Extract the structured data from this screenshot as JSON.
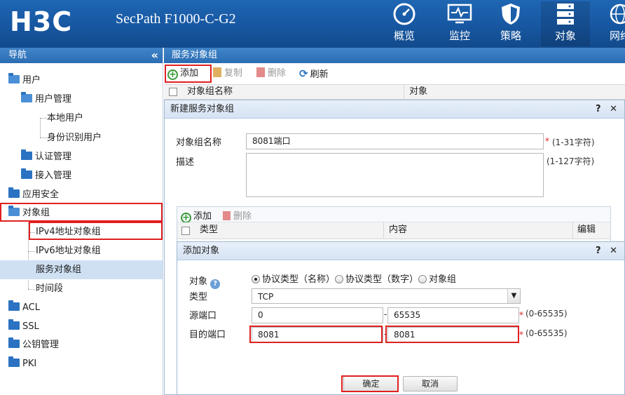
{
  "header": {
    "logo": "H3C",
    "product": "SecPath F1000-C-G2",
    "nav": [
      {
        "label": "概览",
        "icon": "gauge-icon"
      },
      {
        "label": "监控",
        "icon": "monitor-icon"
      },
      {
        "label": "策略",
        "icon": "shield-icon"
      },
      {
        "label": "对象",
        "icon": "server-stack-icon"
      },
      {
        "label": "网络",
        "icon": "globe-icon"
      }
    ],
    "active_nav": "对象"
  },
  "sidebar": {
    "title": "导航",
    "collapse": "«",
    "items": [
      {
        "label": "用户",
        "level": 0,
        "folder": true,
        "open": true
      },
      {
        "label": "用户管理",
        "level": 1,
        "folder": true,
        "open": true
      },
      {
        "label": "本地用户",
        "level": 2,
        "folder": false
      },
      {
        "label": "身份识别用户",
        "level": 2,
        "folder": false
      },
      {
        "label": "认证管理",
        "level": 1,
        "folder": true
      },
      {
        "label": "接入管理",
        "level": 1,
        "folder": true
      },
      {
        "label": "应用安全",
        "level": 0,
        "folder": true
      },
      {
        "label": "对象组",
        "level": 0,
        "folder": true,
        "open": true
      },
      {
        "label": "IPv4地址对象组",
        "level": 1,
        "folder": false
      },
      {
        "label": "IPv6地址对象组",
        "level": 1,
        "folder": false
      },
      {
        "label": "服务对象组",
        "level": 1,
        "folder": false,
        "selected": true
      },
      {
        "label": "时间段",
        "level": 1,
        "folder": false
      },
      {
        "label": "ACL",
        "level": 0,
        "folder": true
      },
      {
        "label": "SSL",
        "level": 0,
        "folder": true
      },
      {
        "label": "公钥管理",
        "level": 0,
        "folder": true
      },
      {
        "label": "PKI",
        "level": 0,
        "folder": true
      }
    ]
  },
  "main": {
    "title": "服务对象组",
    "toolbar": {
      "add": "添加",
      "copy": "复制",
      "delete": "删除",
      "refresh": "刷新"
    },
    "columns": [
      "对象组名称",
      "对象"
    ]
  },
  "dialog_new_group": {
    "title": "新建服务对象组",
    "help": "?",
    "close": "✕",
    "name_label": "对象组名称",
    "name_value": "8081端口",
    "name_required": "*",
    "name_hint": "(1-31字符)",
    "desc_label": "描述",
    "desc_value": "",
    "desc_hint": "(1-127字符)",
    "inner_toolbar": {
      "add": "添加",
      "delete": "删除"
    },
    "inner_columns": [
      "类型",
      "内容",
      "编辑"
    ]
  },
  "dialog_add_object": {
    "title": "添加对象",
    "help": "?",
    "close": "✕",
    "object_label": "对象",
    "object_help": "?",
    "object_options": [
      "协议类型（名称）",
      "协议类型（数字）",
      "对象组"
    ],
    "object_selected": "协议类型（名称）",
    "type_label": "类型",
    "type_value": "TCP",
    "src_port_label": "源端口",
    "src_port_from": "0",
    "src_port_dash": "-",
    "src_port_to": "65535",
    "src_required": "*",
    "src_hint": "(0-65535)",
    "dst_port_label": "目的端口",
    "dst_port_from": "8081",
    "dst_port_dash": "-",
    "dst_port_to": "8081",
    "dst_required": "*",
    "dst_hint": "(0-65535)",
    "ok": "确定",
    "cancel": "取消"
  }
}
